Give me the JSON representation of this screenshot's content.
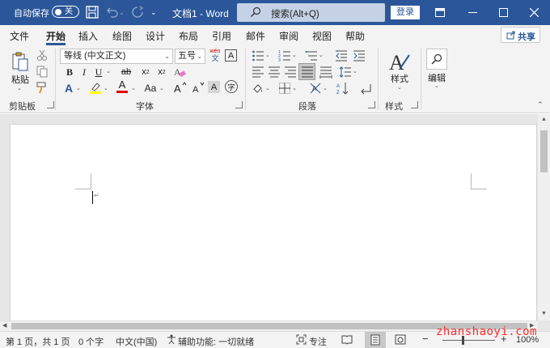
{
  "titlebar": {
    "autosave_label": "自动保存",
    "autosave_state": "关",
    "doc_title": "文档1 - Word",
    "search_text": "搜索(Alt+Q)",
    "login_label": "登录",
    "bg_color": "#2b579a"
  },
  "tabs": [
    "文件",
    "开始",
    "插入",
    "绘图",
    "设计",
    "布局",
    "引用",
    "邮件",
    "审阅",
    "视图",
    "帮助"
  ],
  "active_tab": "开始",
  "share_label": "共享",
  "ribbon": {
    "clipboard": {
      "paste_label": "粘贴",
      "group_label": "剪贴板"
    },
    "font": {
      "font_name": "等线 (中文正文)",
      "font_size": "五号",
      "phonetic_top": "wén",
      "phonetic_bottom": "文",
      "group_label": "字体",
      "letter_A": "A",
      "text_effect_color": "#2b579a",
      "highlight_color": "#ffff00",
      "font_color": "#e00000",
      "aa_label": "Aa",
      "boxed_a": "A",
      "enclosed_char": "字"
    },
    "paragraph": {
      "group_label": "段落"
    },
    "styles": {
      "button_label": "样式",
      "group_label": "样式"
    },
    "editing": {
      "button_label": "编辑"
    }
  },
  "statusbar": {
    "page": "第 1 页，共 1 页",
    "words": "0 个字",
    "language": "中文(中国)",
    "accessibility": "辅助功能: 一切就绪",
    "focus": "专注",
    "zoom": "100%"
  },
  "watermark": "zhanshaoyi.com"
}
